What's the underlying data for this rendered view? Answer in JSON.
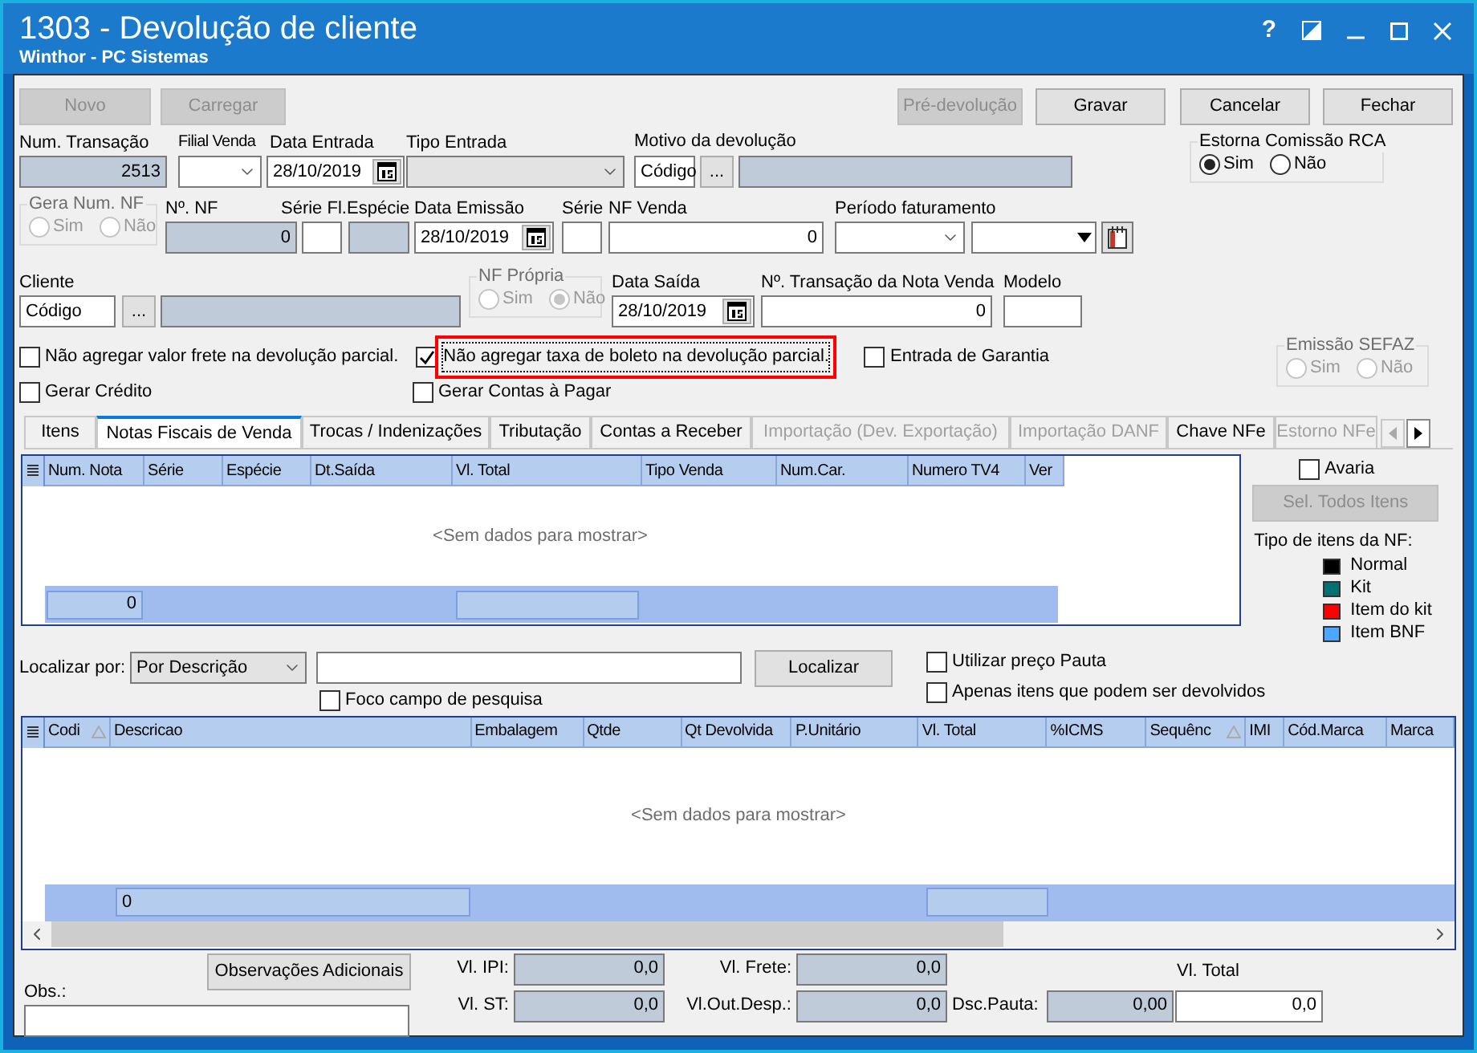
{
  "window": {
    "title": "1303 - Devolução de cliente",
    "subtitle": "Winthor - PC Sistemas",
    "help": "?"
  },
  "toolbar_left": [
    {
      "label": "Novo",
      "disabled": true
    },
    {
      "label": "Carregar",
      "disabled": true
    }
  ],
  "toolbar_right": [
    {
      "label": "Pré-devolução",
      "disabled": true
    },
    {
      "label": "Gravar",
      "disabled": false
    },
    {
      "label": "Cancelar",
      "disabled": false
    },
    {
      "label": "Fechar",
      "disabled": false
    }
  ],
  "header": {
    "num_transacao": {
      "label": "Num. Transação",
      "value": "2513"
    },
    "filial_venda": {
      "label": "Filial Venda"
    },
    "data_entrada": {
      "label": "Data Entrada",
      "value": "28/10/2019"
    },
    "tipo_entrada": {
      "label": "Tipo Entrada"
    },
    "motivo": {
      "label": "Motivo da devolução",
      "value": "Código",
      "button": "..."
    },
    "estorna_comissao": {
      "label": "Estorna Comissão RCA",
      "disabled": false,
      "options": [
        {
          "label": "Sim",
          "selected": true
        },
        {
          "label": "Não",
          "selected": false
        }
      ]
    },
    "gera_num_nf": {
      "label": "Gera Num. NF",
      "disabled": true,
      "options": [
        {
          "label": "Sim",
          "selected": false
        },
        {
          "label": "Não",
          "selected": false
        }
      ]
    },
    "num_nf": {
      "label": "Nº. NF",
      "value": "0"
    },
    "serie_fl": {
      "label": "Série Fl."
    },
    "especie": {
      "label": "Espécie"
    },
    "data_emissao": {
      "label": "Data Emissão",
      "value": "28/10/2019"
    },
    "serie": {
      "label": "Série"
    },
    "nf_venda": {
      "label": "NF Venda",
      "value": "0"
    },
    "periodo": {
      "label": "Período faturamento"
    },
    "cliente": {
      "label": "Cliente",
      "value": "Código",
      "button": "..."
    },
    "nf_propria": {
      "label": "NF Própria",
      "disabled": true,
      "options": [
        {
          "label": "Sim",
          "selected": false
        },
        {
          "label": "Não",
          "selected": true
        }
      ]
    },
    "data_saida": {
      "label": "Data Saída",
      "value": "28/10/2019"
    },
    "num_transacao_venda": {
      "label": "Nº. Transação da Nota Venda",
      "value": "0"
    },
    "modelo": {
      "label": "Modelo"
    }
  },
  "checks": [
    {
      "label": "Não agregar valor frete na devolução parcial.",
      "checked": false,
      "highlighted": false
    },
    {
      "label": "Não agregar taxa de boleto na devolução parcial.",
      "checked": true,
      "highlighted": true
    },
    {
      "label": "Entrada de Garantia",
      "checked": false,
      "highlighted": false
    },
    {
      "label": "Gerar Crédito",
      "checked": false,
      "highlighted": false
    },
    {
      "label": "Gerar Contas à Pagar",
      "checked": false,
      "highlighted": false
    }
  ],
  "emissao_sefaz": {
    "label": "Emissão SEFAZ",
    "disabled": true,
    "options": [
      {
        "label": "Sim",
        "selected": false
      },
      {
        "label": "Não",
        "selected": false
      }
    ]
  },
  "tabs": [
    {
      "label": "Itens",
      "selected": false,
      "disabled": false
    },
    {
      "label": "Notas Fiscais de Venda",
      "selected": true,
      "disabled": false
    },
    {
      "label": "Trocas / Indenizações",
      "selected": false,
      "disabled": false
    },
    {
      "label": "Tributação",
      "selected": false,
      "disabled": false
    },
    {
      "label": "Contas a Receber",
      "selected": false,
      "disabled": false
    },
    {
      "label": "Importação (Dev. Exportação)",
      "selected": false,
      "disabled": true
    },
    {
      "label": "Importação DANF",
      "selected": false,
      "disabled": true
    },
    {
      "label": "Chave NFe",
      "selected": false,
      "disabled": false
    },
    {
      "label": "Estorno NFe",
      "selected": false,
      "disabled": true
    }
  ],
  "notas_grid": {
    "columns": [
      {
        "label": "Num. Nota",
        "sorted": false
      },
      {
        "label": "Série",
        "sorted": false
      },
      {
        "label": "Espécie",
        "sorted": false
      },
      {
        "label": "Dt.Saída",
        "sorted": false
      },
      {
        "label": "Vl. Total",
        "sorted": false
      },
      {
        "label": "Tipo Venda",
        "sorted": false
      },
      {
        "label": "Num.Car.",
        "sorted": false
      },
      {
        "label": "Numero TV4",
        "sorted": false
      },
      {
        "label": "Ver",
        "sorted": false
      }
    ],
    "empty_message": "<Sem dados para mostrar>",
    "footer_count": "0"
  },
  "side_panel": {
    "avaria": {
      "label": "Avaria",
      "checked": false
    },
    "select_all": {
      "label": "Sel. Todos Itens",
      "disabled": true
    },
    "legend_title": "Tipo de itens da NF:",
    "legend": [
      {
        "label": "Normal",
        "color": "#000000"
      },
      {
        "label": "Kit",
        "color": "#007070"
      },
      {
        "label": "Item do kit",
        "color": "#ff0000"
      },
      {
        "label": "Item BNF",
        "color": "#4da6ff"
      }
    ]
  },
  "search": {
    "label": "Localizar por:",
    "mode": "Por Descrição",
    "button": "Localizar",
    "checks": [
      {
        "label": "Foco campo de pesquisa",
        "checked": false
      },
      {
        "label": "Utilizar preço Pauta",
        "checked": false
      },
      {
        "label": "Apenas itens que podem ser devolvidos",
        "checked": false
      }
    ]
  },
  "items_grid": {
    "columns": [
      {
        "label": "Codi",
        "sorted": true
      },
      {
        "label": "Descricao",
        "sorted": false
      },
      {
        "label": "Embalagem",
        "sorted": false
      },
      {
        "label": "Qtde",
        "sorted": false
      },
      {
        "label": "Qt Devolvida",
        "sorted": false
      },
      {
        "label": "P.Unitário",
        "sorted": false
      },
      {
        "label": "Vl. Total",
        "sorted": false
      },
      {
        "label": "%ICMS",
        "sorted": false
      },
      {
        "label": "Sequênc",
        "sorted": true
      },
      {
        "label": "IMI",
        "sorted": false
      },
      {
        "label": "Cód.Marca",
        "sorted": false
      },
      {
        "label": "Marca",
        "sorted": false
      }
    ],
    "empty_message": "<Sem dados para mostrar>",
    "footer_count": "0"
  },
  "totals": {
    "obs_button": "Observações Adicionais",
    "obs_label": "Obs.:",
    "ipi": {
      "label": "Vl. IPI:",
      "value": "0,0"
    },
    "st": {
      "label": "Vl. ST:",
      "value": "0,0"
    },
    "frete": {
      "label": "Vl. Frete:",
      "value": "0,0"
    },
    "out_desp": {
      "label": "Vl.Out.Desp.:",
      "value": "0,0"
    },
    "dsc_pauta": {
      "label": "Dsc.Pauta:",
      "value": "0,00"
    },
    "total": {
      "label": "Vl. Total",
      "value": "0,0"
    }
  }
}
